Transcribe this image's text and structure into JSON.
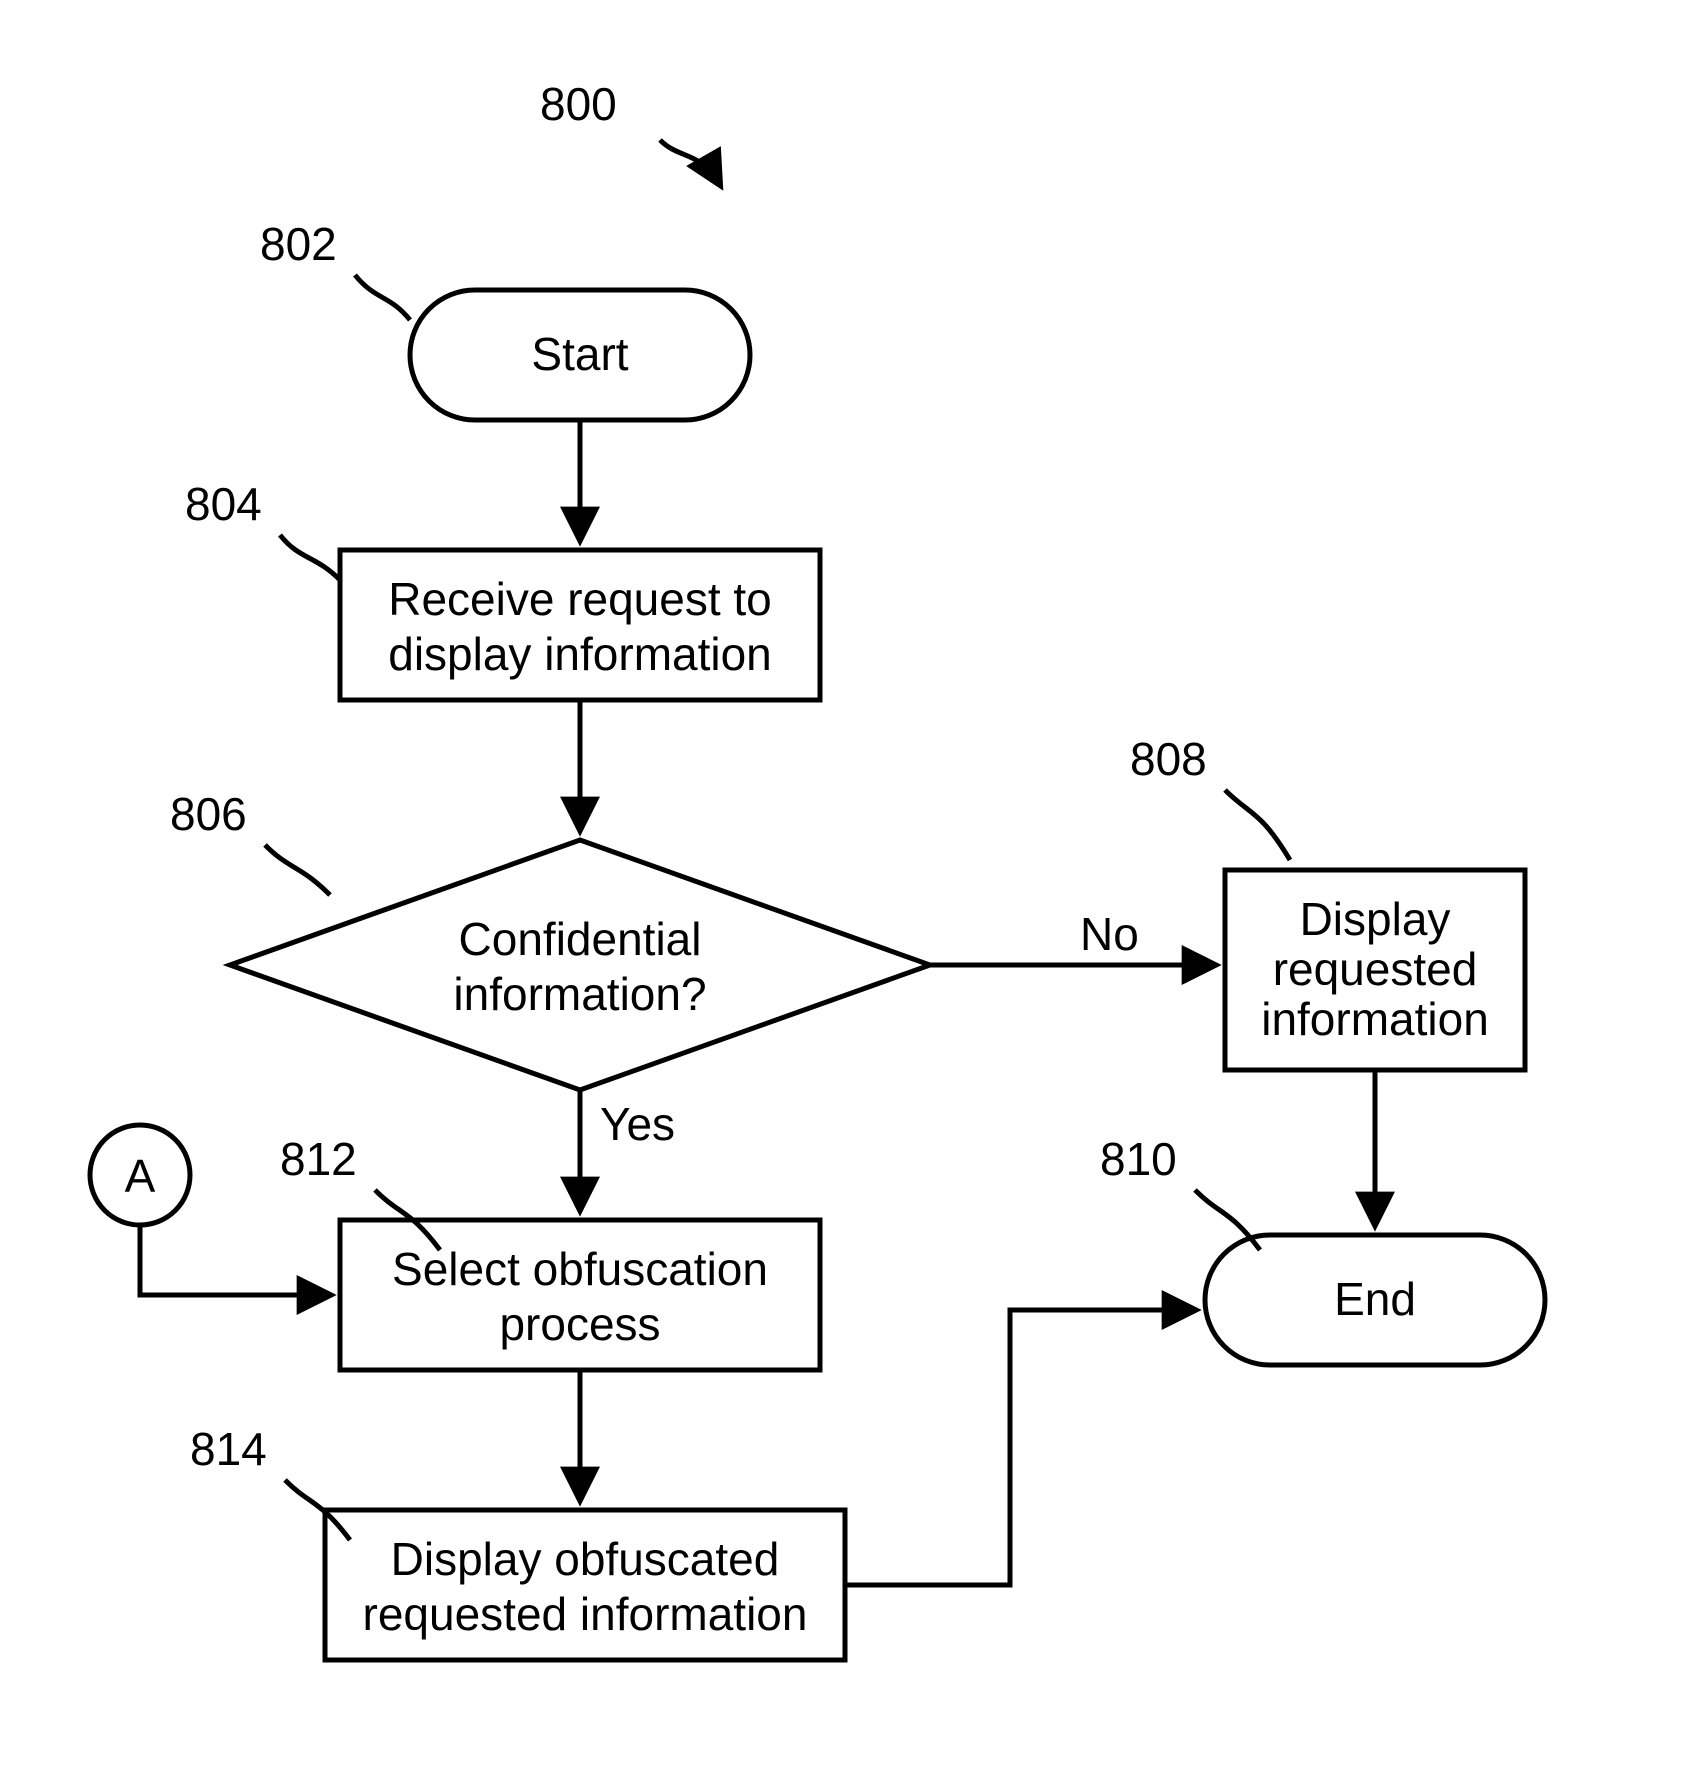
{
  "refs": {
    "ref800": "800",
    "ref802": "802",
    "ref804": "804",
    "ref806": "806",
    "ref808": "808",
    "ref810": "810",
    "ref812": "812",
    "ref814": "814"
  },
  "nodes": {
    "start": "Start",
    "end": "End",
    "connectorA": "A",
    "step804_line1": "Receive request to",
    "step804_line2": "display information",
    "step806_line1": "Confidential",
    "step806_line2": "information?",
    "step808_line1": "Display",
    "step808_line2": "requested",
    "step808_line3": "information",
    "step812_line1": "Select obfuscation",
    "step812_line2": "process",
    "step814_line1": "Display obfuscated",
    "step814_line2": "requested information"
  },
  "edges": {
    "yes": "Yes",
    "no": "No"
  }
}
